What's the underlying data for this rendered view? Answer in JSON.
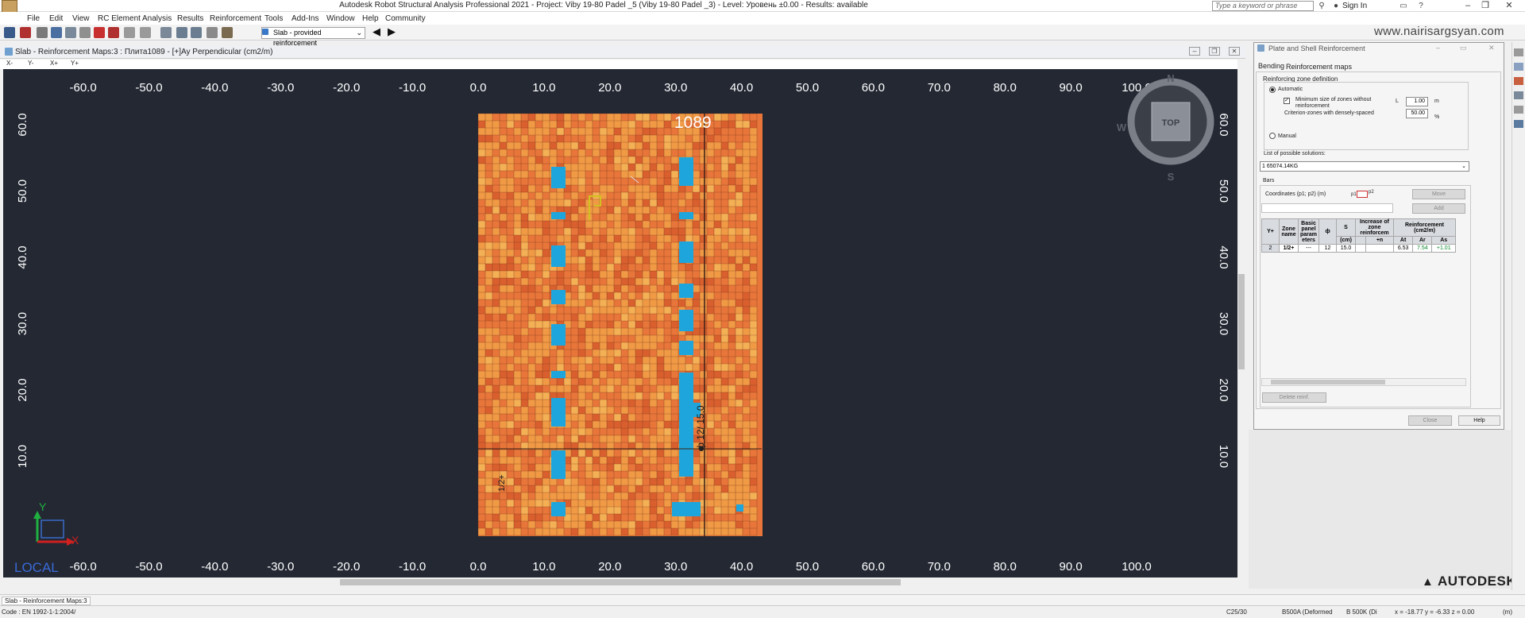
{
  "window": {
    "title": "Autodesk Robot Structural Analysis Professional 2021 - Project: Viby 19-80 Padel _5 (Viby 19-80 Padel _3) - Level: Уровень ±0.00 - Results: available",
    "search_placeholder": "Type a keyword or phrase",
    "sign_in": "Sign In"
  },
  "menu": [
    "File",
    "Edit",
    "View",
    "RC Element",
    "Analysis",
    "Results",
    "Reinforcement",
    "Tools",
    "Add-Ins",
    "Window",
    "Help",
    "Community"
  ],
  "toolbar": {
    "result_select": "Slab - provided reinforcement"
  },
  "watermark": "www.nairisargsyan.com",
  "view": {
    "title": "Slab - Reinforcement Maps:3 : Плита1089 - [+]Ay Perpendicular (cm2/m)",
    "tabs": [
      "X-",
      "Y-",
      "X+",
      "Y+"
    ],
    "x_ticks": [
      "-60.0",
      "-50.0",
      "-40.0",
      "-30.0",
      "-20.0",
      "-10.0",
      "0.0",
      "10.0",
      "20.0",
      "30.0",
      "40.0",
      "50.0",
      "60.0",
      "70.0",
      "80.0",
      "90.0",
      "100.0"
    ],
    "y_ticks": [
      "60.0",
      "50.0",
      "40.0",
      "30.0",
      "20.0",
      "10.0"
    ],
    "slab_label": "1089",
    "zone_label": "1/2+",
    "bar_label": "ф 12/ 15.0",
    "viewcube_top": "TOP",
    "viewcube_n": "N",
    "viewcube_s": "S",
    "viewcube_w": "W",
    "axis_x": "X",
    "axis_y": "Y",
    "axis_local": "LOCAL",
    "colors": {
      "background": "#232833",
      "slab": "#e8763a",
      "cell_light": "#f09a45",
      "cell_dark": "#d9602e",
      "blue": "#1ea6dc",
      "grid_line": "#6b2e18"
    }
  },
  "dialog": {
    "title": "Plate and Shell Reinforcement",
    "tabs": [
      "Bending",
      "Reinforcement maps"
    ],
    "zone_def_label": "Reinforcing zone definition",
    "automatic": "Automatic",
    "min_size_label": "Minimum size of zones without reinforcement",
    "L_label": "L",
    "L_value": "1.00",
    "L_unit": "m",
    "criterion_label": "Criterion-zones with densely-spaced",
    "criterion_value": "50.00",
    "criterion_unit": "%",
    "manual": "Manual",
    "solutions_label": "List of possible solutions:",
    "solution_selected": "1     65074.14KG",
    "bars_tab": "Bars",
    "coords_label": "Coordinates (p1; p2) (m)",
    "p1": "p1",
    "p2": "p2",
    "move_button": "Move",
    "add_button": "Add",
    "delete_button": "Delete reinf.",
    "close_button": "Close",
    "help_button": "Help",
    "table": {
      "headers": [
        "Y+",
        "Zone name",
        "Basic panel param eters",
        "ф",
        "S",
        "Increase of zone reinforcem",
        "Reinforcement (cm2/m)"
      ],
      "subheaders": [
        "",
        "",
        "",
        "",
        "(cm)",
        "",
        "+n",
        "At",
        "Ar",
        "As"
      ],
      "rows": [
        [
          "2",
          "1/2+",
          "---",
          "12",
          "15.0",
          "",
          "",
          "6.53",
          "7.54",
          "+1.01"
        ]
      ]
    }
  },
  "brand": "AUTODESK.",
  "status": {
    "tab": "Slab - Reinforcement Maps:3",
    "code": "Code : EN 1992-1-1:2004/",
    "concrete": "C25/30",
    "steel1": "B500A (Deformed",
    "steel2": "B 500K (Di",
    "coords": "x = -18.77  y = -6.33  z = 0.00",
    "unit": "(m)"
  }
}
